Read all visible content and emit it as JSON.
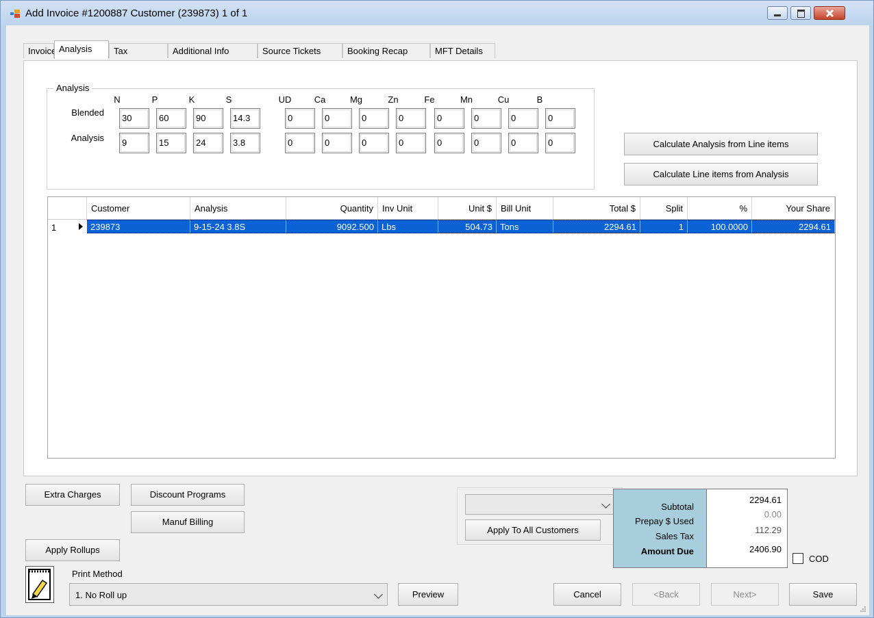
{
  "window": {
    "title": "Add Invoice #1200887 Customer (239873) 1 of 1"
  },
  "tabs": [
    "Invoice",
    "Analysis",
    "Tax",
    "Additional Info",
    "Source Tickets",
    "Booking Recap",
    "MFT Details"
  ],
  "analysis": {
    "group_label": "Analysis",
    "headers": [
      "N",
      "P",
      "K",
      "S",
      "UD",
      "Ca",
      "Mg",
      "Zn",
      "Fe",
      "Mn",
      "Cu",
      "B"
    ],
    "blended_label": "Blended",
    "analysis_label": "Analysis",
    "blended": [
      "30",
      "60",
      "90",
      "14.3",
      "0",
      "0",
      "0",
      "0",
      "0",
      "0",
      "0",
      "0"
    ],
    "analysis": [
      "9",
      "15",
      "24",
      "3.8",
      "0",
      "0",
      "0",
      "0",
      "0",
      "0",
      "0",
      "0"
    ]
  },
  "buttons": {
    "calc_analysis": "Calculate Analysis from Line items",
    "calc_line_items": "Calculate Line items from Analysis",
    "extra_charges": "Extra Charges",
    "discount_programs": "Discount Programs",
    "manuf_billing": "Manuf Billing",
    "apply_rollups": "Apply Rollups",
    "apply_all": "Apply To All Customers",
    "preview": "Preview",
    "cancel": "Cancel",
    "back": "<Back",
    "next": "Next>",
    "save": "Save"
  },
  "grid": {
    "columns": [
      "Customer",
      "Analysis",
      "Quantity",
      "Inv Unit",
      "Unit $",
      "Bill Unit",
      "Total $",
      "Split",
      "%",
      "Your Share"
    ],
    "rows": [
      {
        "num": "1",
        "customer": "239873",
        "analysis": "9-15-24 3.8S",
        "quantity": "9092.500",
        "inv_unit": "Lbs",
        "unit_price": "504.73",
        "bill_unit": "Tons",
        "total": "2294.61",
        "split": "1",
        "pct": "100.0000",
        "share": "2294.61"
      }
    ]
  },
  "totals": {
    "subtotal_label": "Subtotal",
    "subtotal": "2294.61",
    "prepay_label": "Prepay $ Used",
    "prepay": "0.00",
    "tax_label": "Sales Tax",
    "tax": "112.29",
    "due_label": "Amount Due",
    "due": "2406.90"
  },
  "cod_label": "COD",
  "print_method": {
    "label": "Print Method",
    "value": "1. No Roll up"
  },
  "apply_combo": {
    "value": ""
  }
}
